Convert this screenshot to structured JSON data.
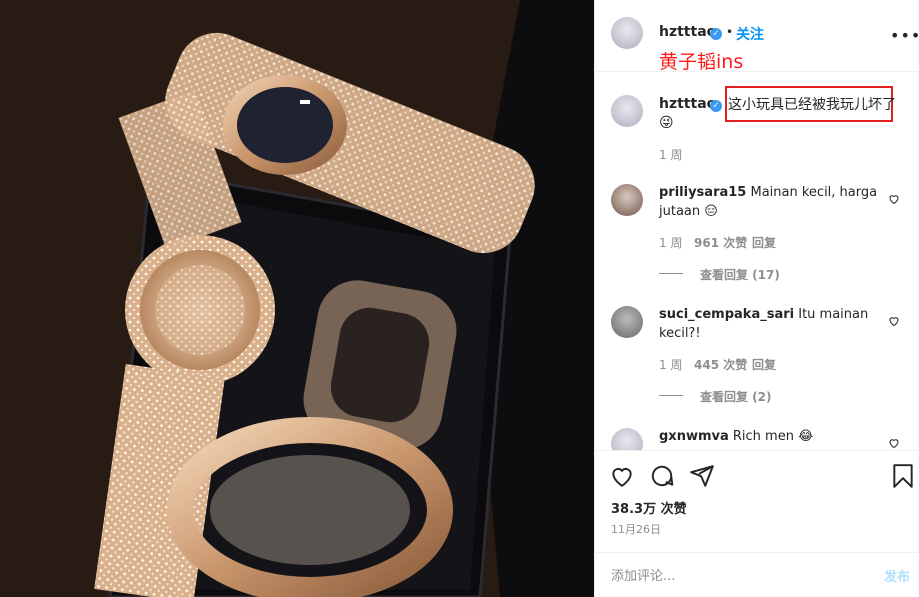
{
  "post": {
    "author": "hztttao",
    "follow_label": "关注",
    "more_label": "•••",
    "annotation": "黄子韬ins",
    "caption": "这小玩具已经被我玩儿坏了",
    "caption_emoji": "😜",
    "caption_time": "1 周"
  },
  "comments": [
    {
      "user": "priliysara15",
      "text_line1": "Mainan kecil, harga",
      "text_line2": "jutaan",
      "emoji": "😑",
      "time": "1 周",
      "likes": "961 次赞",
      "reply_label": "回复",
      "view_replies": "查看回复 (17)"
    },
    {
      "user": "suci_cempaka_sari",
      "text_line1": "Itu mainan",
      "text_line2": "kecil?!",
      "time": "1 周",
      "likes": "445 次赞",
      "reply_label": "回复",
      "view_replies": "查看回复 (2)"
    },
    {
      "user": "gxnwmva",
      "text_line1": "Rich men",
      "emoji": "😂"
    }
  ],
  "stats": {
    "likes": "38.3万 次赞",
    "date": "11月26日"
  },
  "comment_bar": {
    "placeholder": "添加评论...",
    "post_label": "发布"
  },
  "icons": [
    "heart-icon",
    "comment-icon",
    "share-icon",
    "bookmark-icon",
    "verified-icon"
  ],
  "colors": {
    "accent": "#0095f6",
    "verified": "#3897f0",
    "annotation": "#ff1a1a",
    "muted": "#8e8e8e"
  }
}
